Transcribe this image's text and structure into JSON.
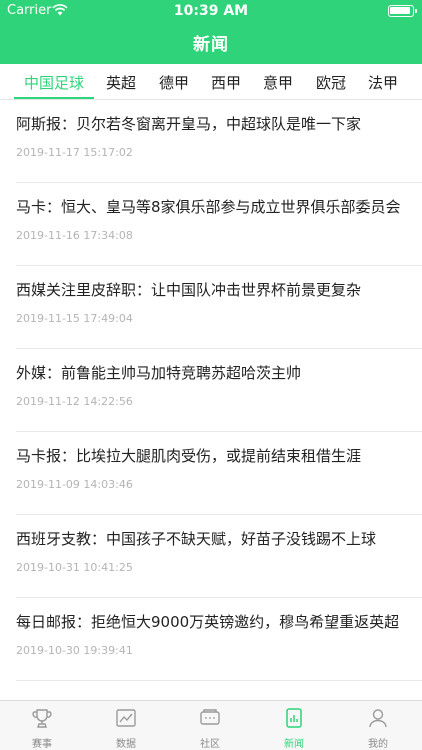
{
  "status_bar": {
    "carrier": "Carrier",
    "time": "10:39 AM"
  },
  "header": {
    "title": "新闻"
  },
  "tabs": [
    {
      "label": "中国足球",
      "active": true
    },
    {
      "label": "英超"
    },
    {
      "label": "德甲"
    },
    {
      "label": "西甲"
    },
    {
      "label": "意甲"
    },
    {
      "label": "欧冠"
    },
    {
      "label": "法甲"
    }
  ],
  "news": [
    {
      "headline": "阿斯报：贝尔若冬窗离开皇马，中超球队是唯一下家",
      "time": "2019-11-17 15:17:02"
    },
    {
      "headline": "马卡：恒大、皇马等8家俱乐部参与成立世界俱乐部委员会",
      "time": "2019-11-16 17:34:08"
    },
    {
      "headline": "西媒关注里皮辞职：让中国队冲击世界杯前景更复杂",
      "time": "2019-11-15 17:49:04"
    },
    {
      "headline": "外媒：前鲁能主帅马加特竞聘苏超哈茨主帅",
      "time": "2019-11-12 14:22:56"
    },
    {
      "headline": "马卡报：比埃拉大腿肌肉受伤，或提前结束租借生涯",
      "time": "2019-11-09 14:03:46"
    },
    {
      "headline": "西班牙支教：中国孩子不缺天赋，好苗子没钱踢不上球",
      "time": "2019-10-31 10:41:25"
    },
    {
      "headline": "每日邮报：拒绝恒大9000万英镑邀约，穆鸟希望重返英超",
      "time": "2019-10-30 19:39:41"
    }
  ],
  "tabbar": [
    {
      "label": "赛事",
      "icon": "trophy-icon"
    },
    {
      "label": "数据",
      "icon": "chart-icon"
    },
    {
      "label": "社区",
      "icon": "community-icon"
    },
    {
      "label": "新闻",
      "icon": "news-icon",
      "active": true
    },
    {
      "label": "我的",
      "icon": "profile-icon"
    }
  ],
  "colors": {
    "accent": "#2fd47a",
    "text": "#222222",
    "muted": "#b4b4b4",
    "tab_inactive": "#8a8a8a"
  }
}
